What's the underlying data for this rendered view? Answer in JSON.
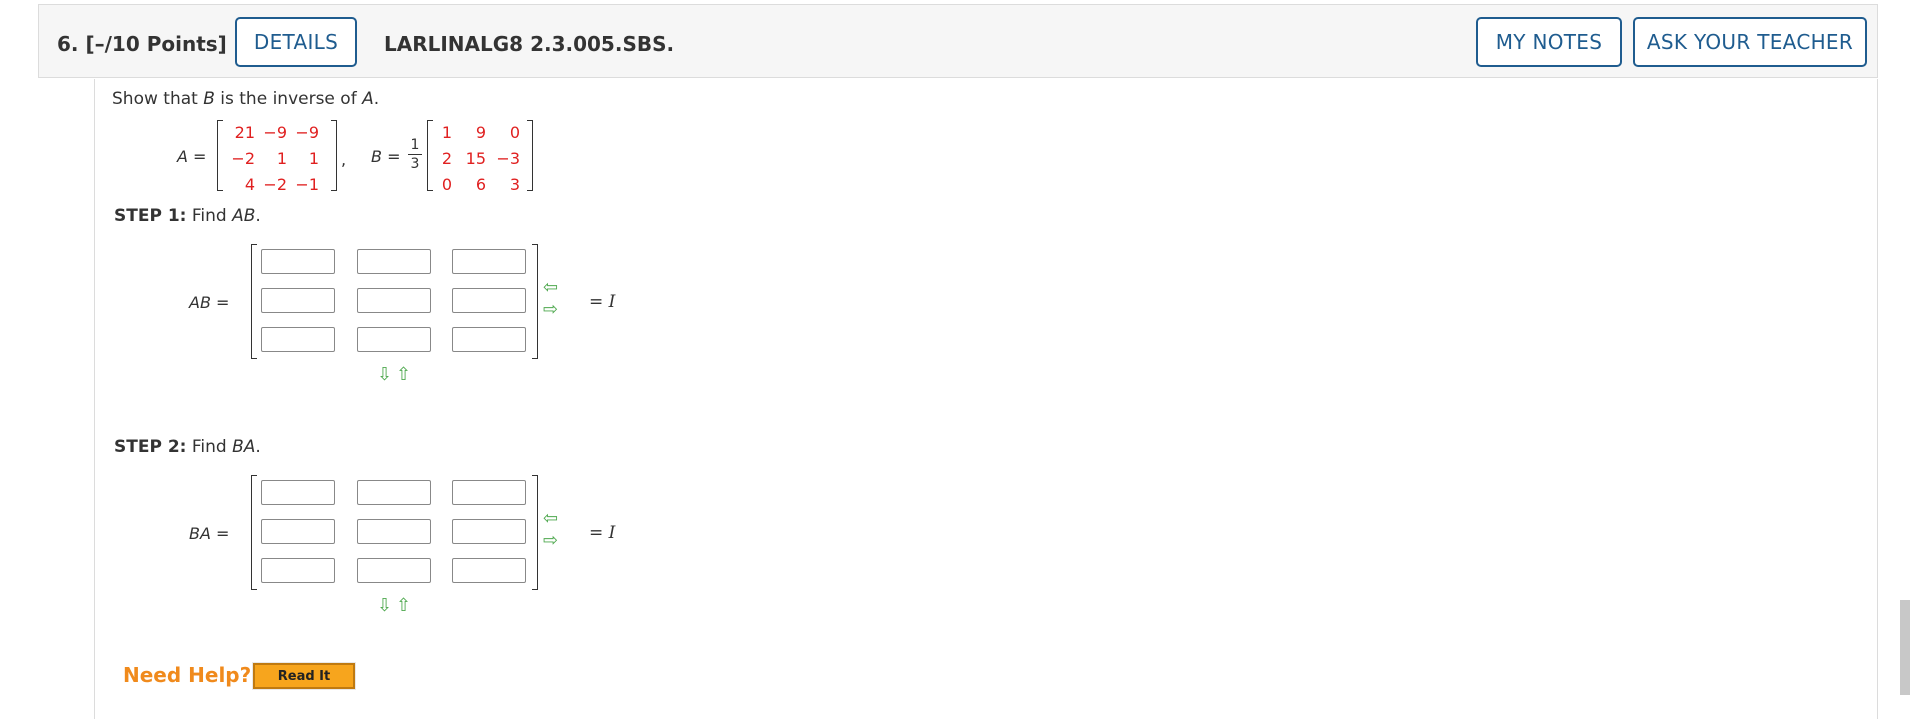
{
  "header": {
    "question_number": "6.",
    "points": "[–/10 Points]",
    "details_label": "DETAILS",
    "code": "LARLINALG8 2.3.005.SBS.",
    "my_notes_label": "MY NOTES",
    "ask_teacher_label": "ASK YOUR TEACHER"
  },
  "problem": {
    "prompt_pre": "Show that ",
    "prompt_b": "B",
    "prompt_mid": " is the inverse of ",
    "prompt_a": "A",
    "prompt_end": ".",
    "A_label": "A",
    "B_label": "B",
    "equals": "=",
    "comma": ",",
    "frac_num": "1",
    "frac_den": "3",
    "A": [
      [
        "21",
        "−9",
        "−9"
      ],
      [
        "−2",
        "1",
        "1"
      ],
      [
        "4",
        "−2",
        "−1"
      ]
    ],
    "B": [
      [
        "1",
        "9",
        "0"
      ],
      [
        "2",
        "15",
        "−3"
      ],
      [
        "0",
        "6",
        "3"
      ]
    ]
  },
  "step1": {
    "label": "STEP 1:",
    "text": "Find ",
    "var": "AB",
    "end": ".",
    "matrix_label": "AB =",
    "equals_text": "= ",
    "identity": "I"
  },
  "step2": {
    "label": "STEP 2:",
    "text": "Find ",
    "var": "BA",
    "end": ".",
    "matrix_label": "BA =",
    "equals_text": "= ",
    "identity": "I"
  },
  "help": {
    "label": "Need Help?",
    "read_it_label": "Read It"
  },
  "colors": {
    "accent": "#1f5c8f",
    "matrix_entries": "#e02020",
    "help": "#f08a1c",
    "arrow": "#4ea84e"
  },
  "icons": {
    "col_remove": "arrow-left-icon",
    "col_add": "arrow-right-icon",
    "row_add": "arrow-down-icon",
    "row_remove": "arrow-up-icon"
  }
}
